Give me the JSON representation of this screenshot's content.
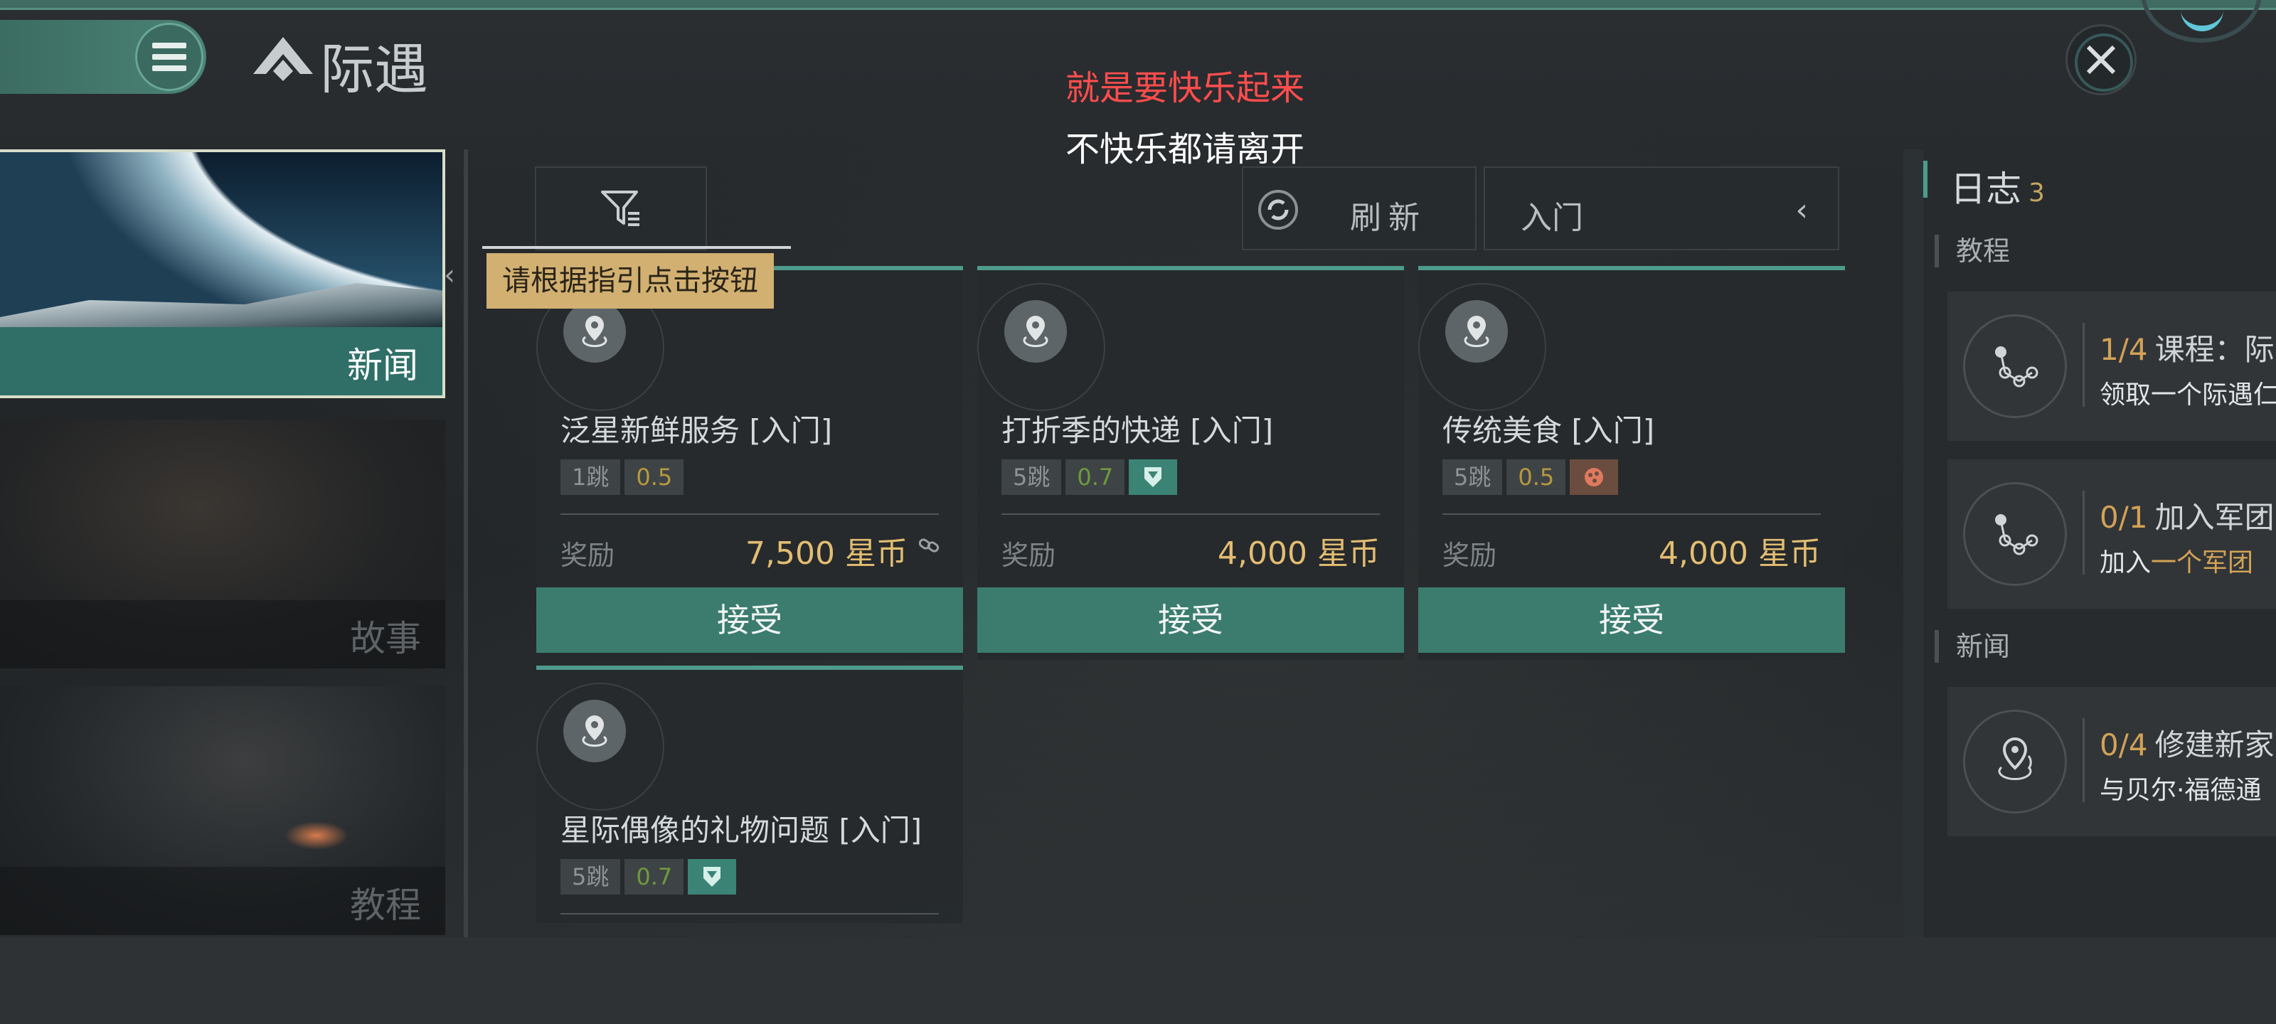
{
  "header": {
    "title": "际遇",
    "notice_red": "就是要快乐起来",
    "notice_white": "不快乐都请离开"
  },
  "nav": {
    "items": [
      {
        "label": "新闻",
        "active": true
      },
      {
        "label": "故事",
        "active": false
      },
      {
        "label": "教程",
        "active": false
      }
    ]
  },
  "toolbar": {
    "refresh_label": "刷新",
    "level_select": "入门",
    "tooltip": "请根据指引点击按钮"
  },
  "missions": [
    {
      "title": "泛星新鲜服务 [入门]",
      "jumps": "1跳",
      "security": "0.5",
      "reward_label": "奖励",
      "reward": "7,500 星币",
      "accept": "接受"
    },
    {
      "title": "打折季的快递 [入门]",
      "jumps": "5跳",
      "security": "0.7",
      "reward_label": "奖励",
      "reward": "4,000 星币",
      "accept": "接受"
    },
    {
      "title": "传统美食 [入门]",
      "jumps": "5跳",
      "security": "0.5",
      "reward_label": "奖励",
      "reward": "4,000 星币",
      "accept": "接受"
    },
    {
      "title": "星际偶像的礼物问题 [入门]",
      "jumps": "5跳",
      "security": "0.7"
    }
  ],
  "log": {
    "title": "日志",
    "count": "3",
    "sections": [
      {
        "label": "教程"
      },
      {
        "label": "新闻"
      }
    ],
    "items": [
      {
        "progress": "1/4",
        "title": "课程：际",
        "desc_pre": "领取一个际遇仁",
        "desc_hl": ""
      },
      {
        "progress": "0/1",
        "title": "加入军团",
        "desc_pre": "加入",
        "desc_hl": "一个军团"
      },
      {
        "progress": "0/4",
        "title": "修建新家",
        "desc_pre": "与贝尔·福德通",
        "desc_hl": ""
      }
    ]
  },
  "colors": {
    "accent_teal": "#4e9b8c",
    "reward_gold": "#e3bd72",
    "notice_red": "#ff4d4d",
    "tooltip_bg": "#d2b071"
  }
}
